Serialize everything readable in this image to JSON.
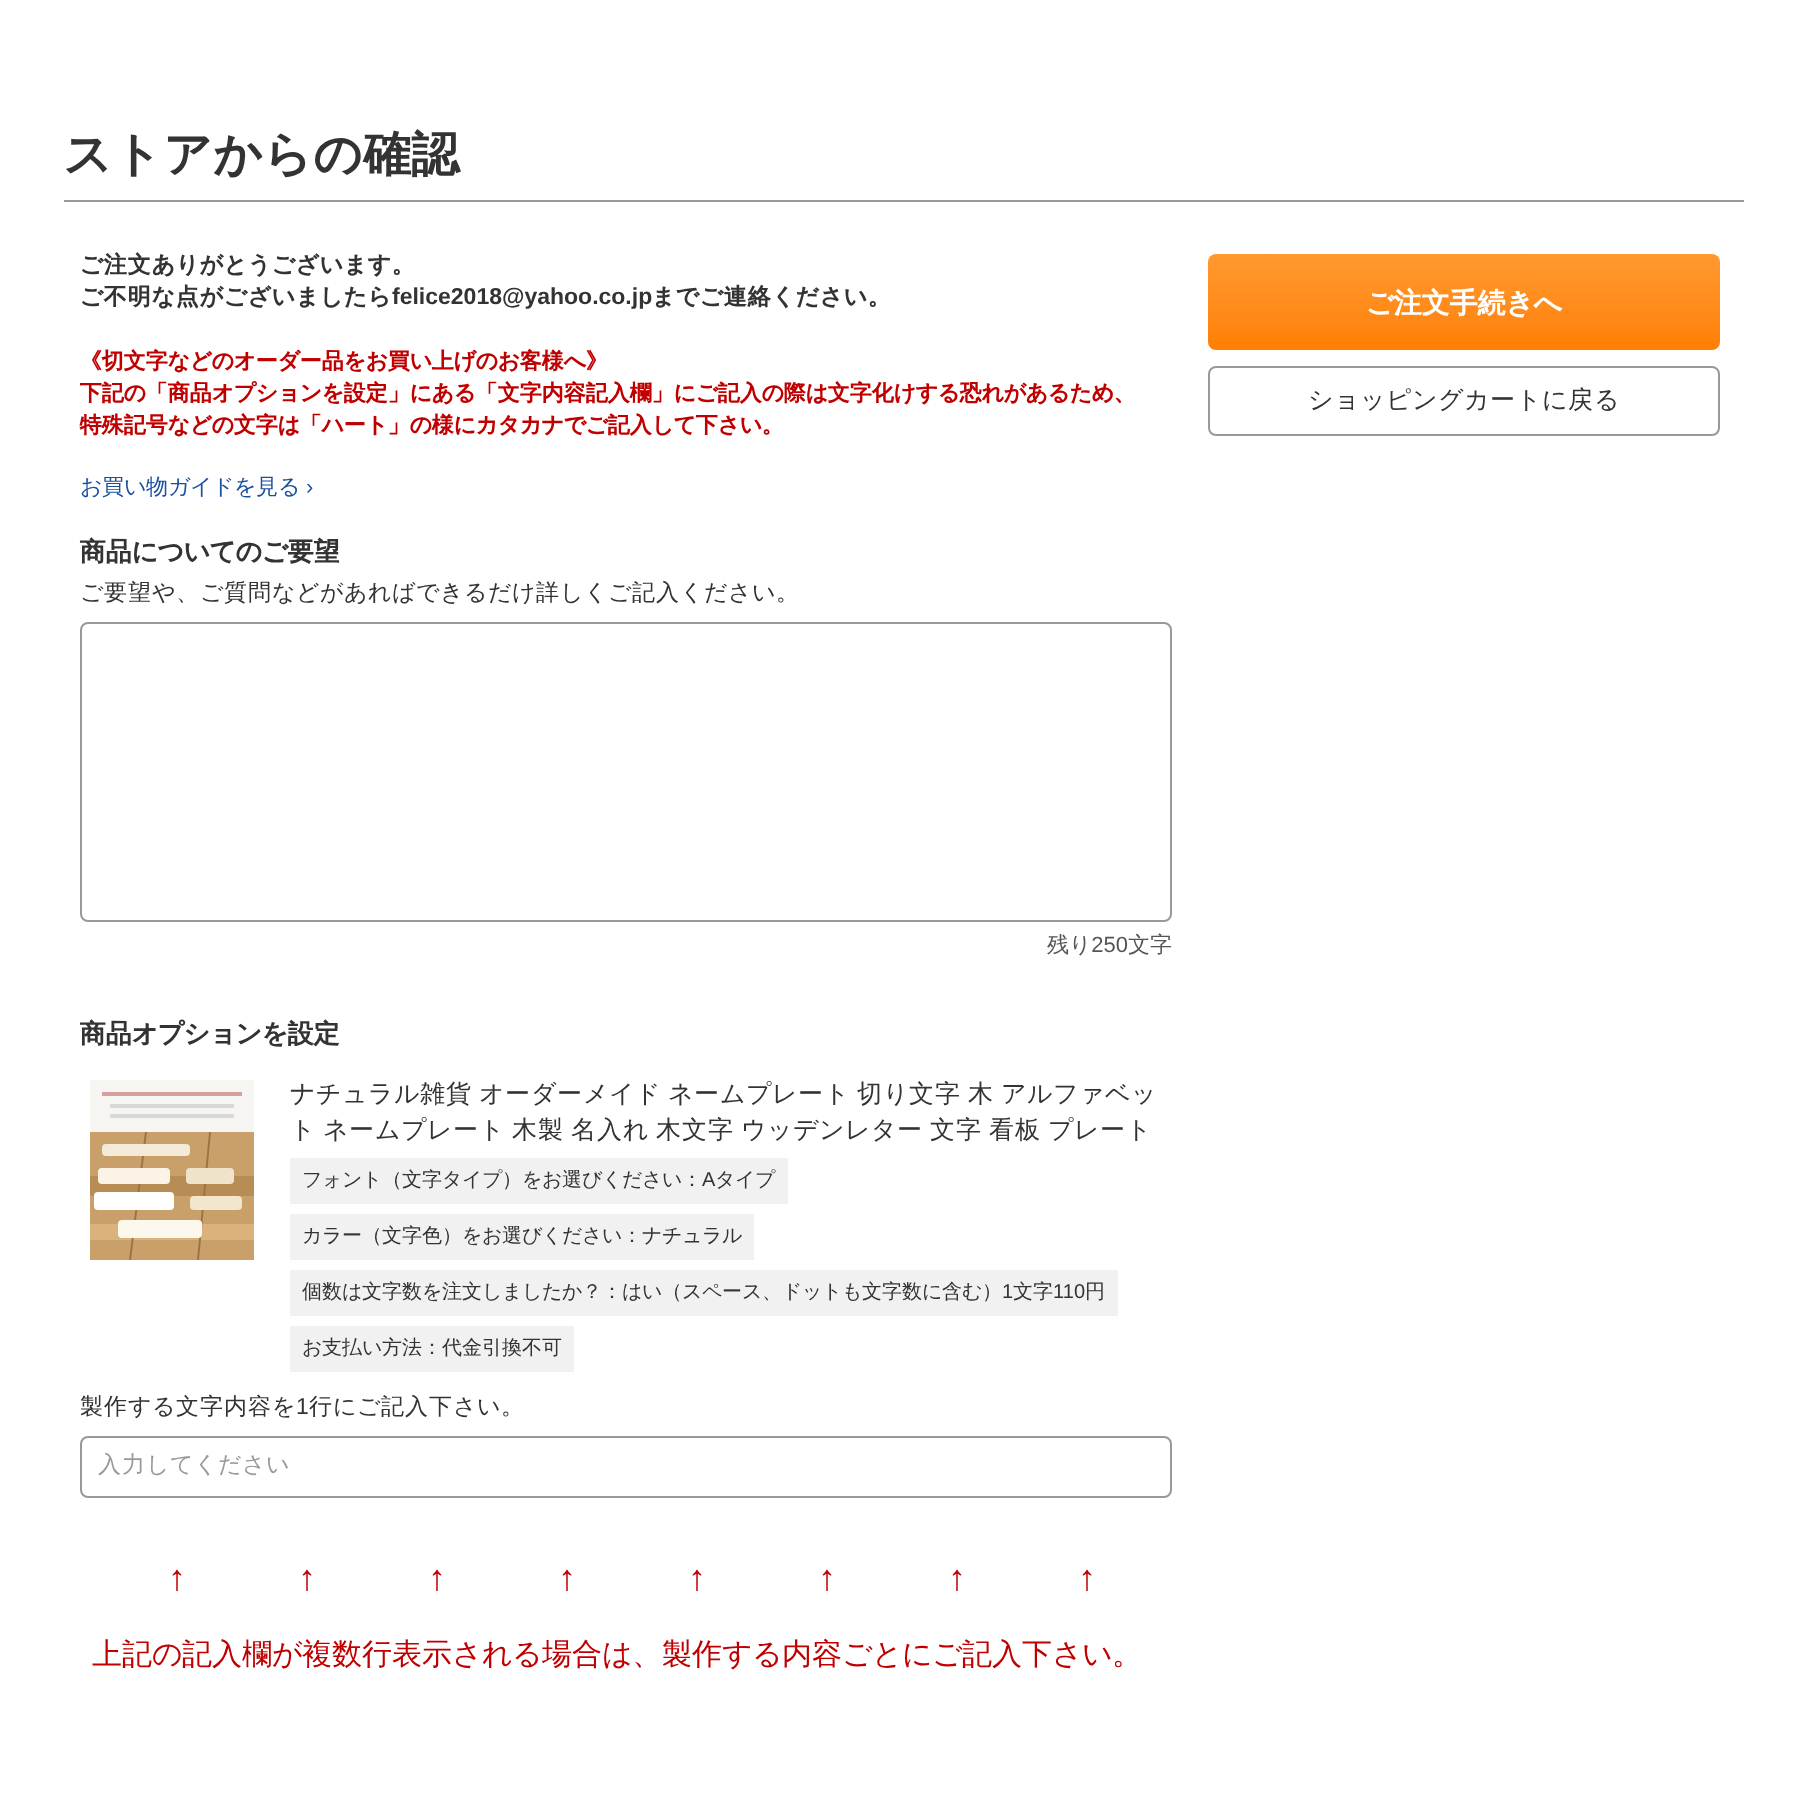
{
  "page_title": "ストアからの確認",
  "intro": [
    "ご注文ありがとうございます。",
    "ご不明な点がございましたらfelice2018@yahoo.co.jpまでご連絡ください。"
  ],
  "notice": [
    "《切文字などのオーダー品をお買い上げのお客様へ》",
    "下記の「商品オプションを設定」にある「文字内容記入欄」にご記入の際は文字化けする恐れがあるため、",
    "特殊記号などの文字は「ハート」の様にカタカナでご記入して下さい。"
  ],
  "guide_link": "お買い物ガイドを見る ›",
  "request": {
    "heading": "商品についてのご要望",
    "hint": "ご要望や、ご質問などがあればできるだけ詳しくご記入ください。",
    "counter": "残り250文字"
  },
  "options": {
    "heading": "商品オプションを設定",
    "product": {
      "name": "ナチュラル雑貨 オーダーメイド ネームプレート 切り文字 木 アルファベット ネームプレート 木製 名入れ 木文字 ウッデンレター 文字 看板 プレート",
      "tags": [
        "フォント（文字タイプ）をお選びください：Aタイプ",
        "カラー（文字色）をお選びください：ナチュラル",
        "個数は文字数を注文しましたか？：はい（スペース、ドットも文字数に含む）1文字110円",
        "お支払い方法：代金引換不可"
      ]
    },
    "text_field": {
      "label": "製作する文字内容を1行にご記入下さい。",
      "placeholder": "入力してください"
    }
  },
  "arrows": [
    "↑",
    "↑",
    "↑",
    "↑",
    "↑",
    "↑",
    "↑",
    "↑"
  ],
  "arrow_note": "上記の記入欄が複数行表示される場合は、製作する内容ごとにご記入下さい。",
  "buttons": {
    "primary": "ご注文手続きへ",
    "secondary": "ショッピングカートに戻る"
  }
}
